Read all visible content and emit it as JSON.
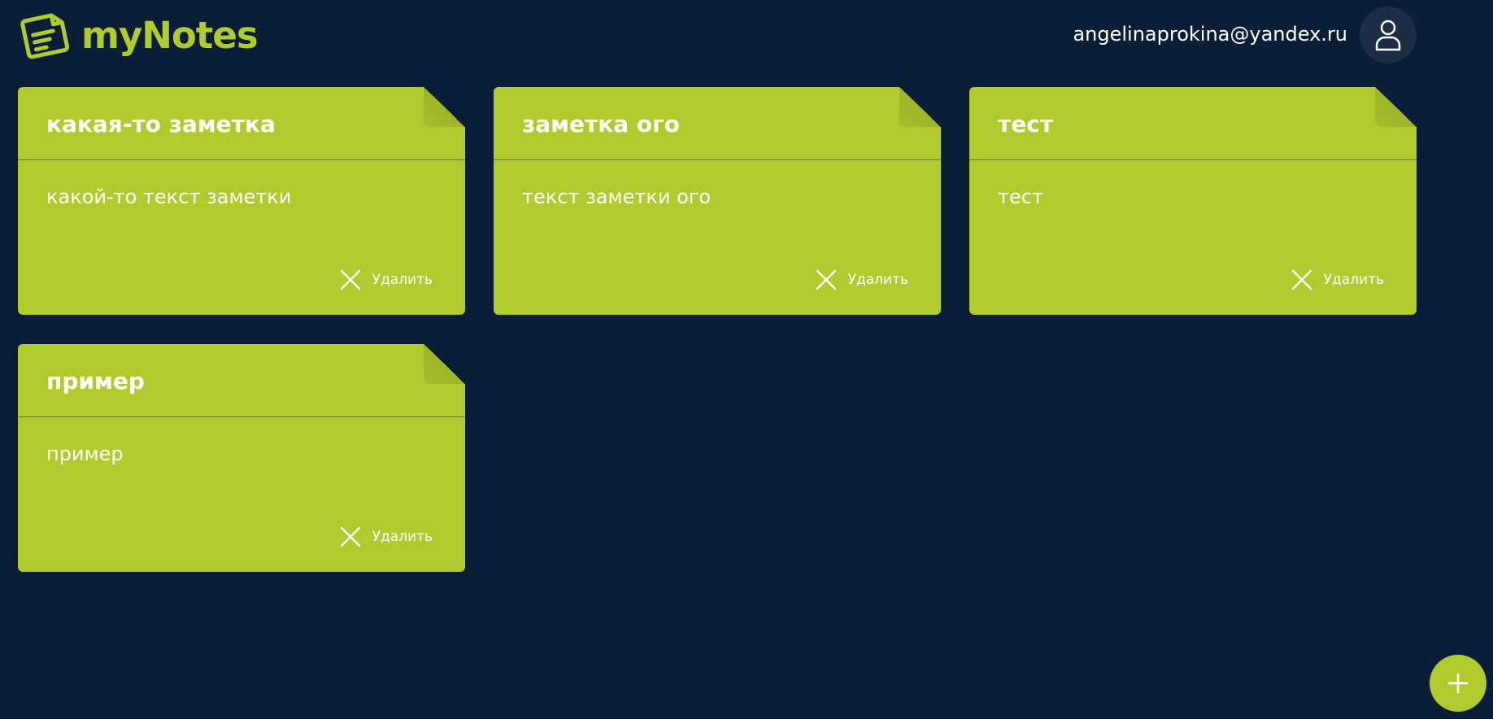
{
  "header": {
    "logo_text": "myNotes",
    "user_email": "angelinaprokina@yandex.ru",
    "icons": {
      "logo": "note-icon",
      "avatar": "user-icon"
    }
  },
  "notes": [
    {
      "title": "какая-то заметка",
      "text": "какой-то текст заметки",
      "delete_label": "Удалить"
    },
    {
      "title": "заметка ого",
      "text": "текст заметки ого",
      "delete_label": "Удалить"
    },
    {
      "title": "тест",
      "text": "тест",
      "delete_label": "Удалить"
    },
    {
      "title": "пример",
      "text": "пример",
      "delete_label": "Удалить"
    }
  ],
  "actions": {
    "add_icon": "plus-icon",
    "delete_icon": "close-icon"
  },
  "colors": {
    "background": "#0b1e37",
    "accent": "#b1cb2e",
    "avatar_bg": "#1c2d45",
    "text": "#ffffff"
  }
}
